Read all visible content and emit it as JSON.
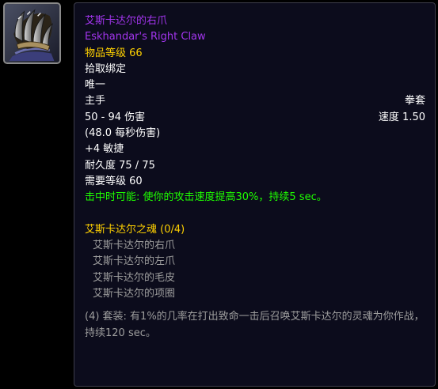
{
  "icon": {
    "name": "claw-weapon-icon"
  },
  "colors": {
    "epic": "#a335ee",
    "yellow": "#ffd100",
    "green": "#1eff00",
    "grey": "#9d9d9d",
    "white": "#ffffff",
    "background": "#0c0c1c"
  },
  "item": {
    "name_cn": "艾斯卡达尔的右爪",
    "name_en": "Eskhandar's Right Claw",
    "item_level": "物品等级 66",
    "binding": "拾取绑定",
    "unique": "唯一",
    "slot": "主手",
    "type": "拳套",
    "damage": "50 - 94 伤害",
    "speed": "速度 1.50",
    "dps": "(48.0 每秒伤害)",
    "stat": "+4 敏捷",
    "durability": "耐久度 75 / 75",
    "required_level": "需要等级 60",
    "chance_on_hit": "击中时可能: 使你的攻击速度提高30%，持续5 sec。"
  },
  "set": {
    "title": "艾斯卡达尔之魂 (0/4)",
    "items": [
      "艾斯卡达尔的右爪",
      "艾斯卡达尔的左爪",
      "艾斯卡达尔的毛皮",
      "艾斯卡达尔的项圈"
    ],
    "bonus": "(4) 套装: 有1%的几率在打出致命一击后召唤艾斯卡达尔的灵魂为你作战，持续120 sec。"
  }
}
